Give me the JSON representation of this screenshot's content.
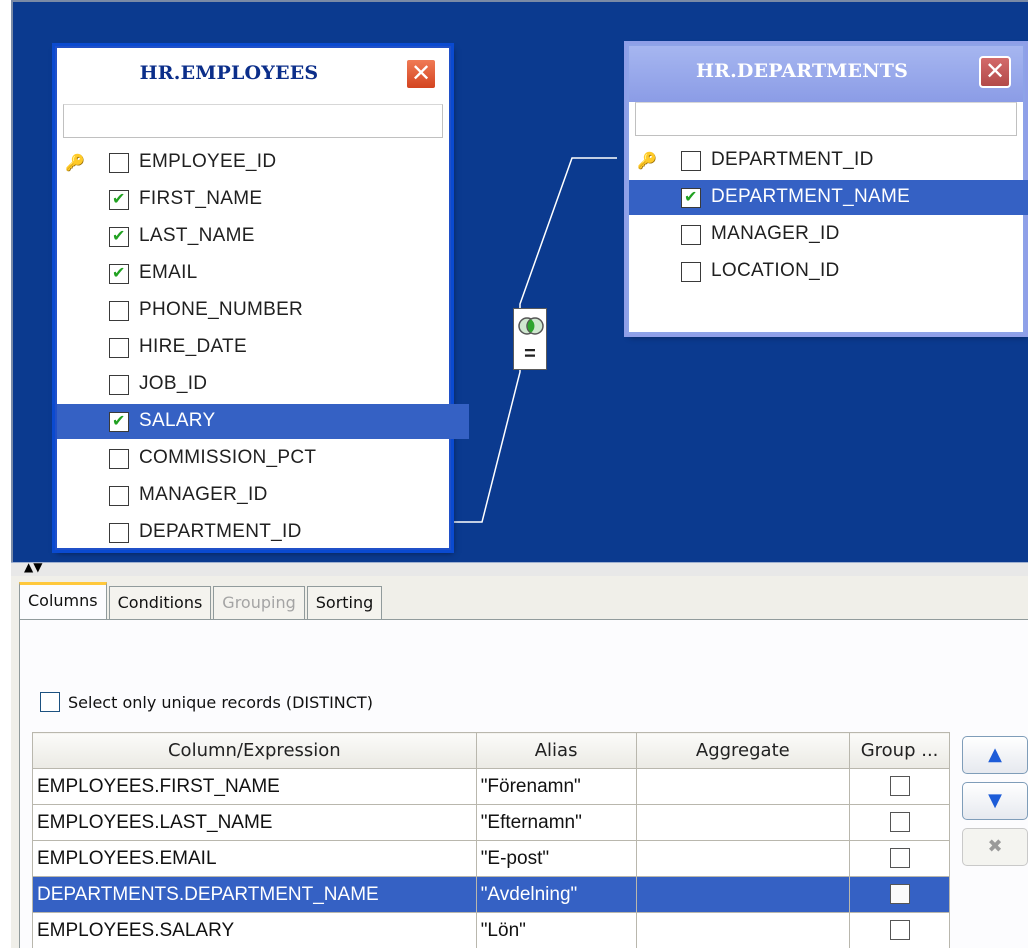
{
  "employees_table": {
    "title": "HR.EMPLOYEES",
    "close_icon": "close-icon",
    "fields": [
      {
        "name": "EMPLOYEE_ID",
        "checked": false,
        "key": true,
        "selected": false
      },
      {
        "name": "FIRST_NAME",
        "checked": true,
        "key": false,
        "selected": false
      },
      {
        "name": "LAST_NAME",
        "checked": true,
        "key": false,
        "selected": false
      },
      {
        "name": "EMAIL",
        "checked": true,
        "key": false,
        "selected": false
      },
      {
        "name": "PHONE_NUMBER",
        "checked": false,
        "key": false,
        "selected": false
      },
      {
        "name": "HIRE_DATE",
        "checked": false,
        "key": false,
        "selected": false
      },
      {
        "name": "JOB_ID",
        "checked": false,
        "key": false,
        "selected": false
      },
      {
        "name": "SALARY",
        "checked": true,
        "key": false,
        "selected": true
      },
      {
        "name": "COMMISSION_PCT",
        "checked": false,
        "key": false,
        "selected": false
      },
      {
        "name": "MANAGER_ID",
        "checked": false,
        "key": false,
        "selected": false
      },
      {
        "name": "DEPARTMENT_ID",
        "checked": false,
        "key": false,
        "selected": false
      }
    ]
  },
  "departments_table": {
    "title": "HR.DEPARTMENTS",
    "close_icon": "close-icon",
    "fields": [
      {
        "name": "DEPARTMENT_ID",
        "checked": false,
        "key": true,
        "selected": false
      },
      {
        "name": "DEPARTMENT_NAME",
        "checked": true,
        "key": false,
        "selected": true
      },
      {
        "name": "MANAGER_ID",
        "checked": false,
        "key": false,
        "selected": false
      },
      {
        "name": "LOCATION_ID",
        "checked": false,
        "key": false,
        "selected": false
      }
    ]
  },
  "join": {
    "operator": "=",
    "icon": "join-venn-icon"
  },
  "tabs": [
    {
      "label": "Columns",
      "active": true,
      "disabled": false
    },
    {
      "label": "Conditions",
      "active": false,
      "disabled": false
    },
    {
      "label": "Grouping",
      "active": false,
      "disabled": true
    },
    {
      "label": "Sorting",
      "active": false,
      "disabled": false
    }
  ],
  "distinct_label": "Select only unique records (DISTINCT)",
  "grid": {
    "headers": [
      "Column/Expression",
      "Alias",
      "Aggregate",
      "Group ..."
    ],
    "rows": [
      {
        "column": "EMPLOYEES.FIRST_NAME",
        "alias": "\"Förenamn\"",
        "aggregate": "",
        "group": false,
        "selected": false
      },
      {
        "column": "EMPLOYEES.LAST_NAME",
        "alias": "\"Efternamn\"",
        "aggregate": "",
        "group": false,
        "selected": false
      },
      {
        "column": "EMPLOYEES.EMAIL",
        "alias": "\"E-post\"",
        "aggregate": "",
        "group": false,
        "selected": false
      },
      {
        "column": "DEPARTMENTS.DEPARTMENT_NAME",
        "alias": "\"Avdelning\"",
        "aggregate": "",
        "group": false,
        "selected": true
      },
      {
        "column": "EMPLOYEES.SALARY",
        "alias": "\"Lön\"",
        "aggregate": "",
        "group": false,
        "selected": false
      },
      {
        "column": "",
        "alias": "",
        "aggregate": "",
        "group": false,
        "selected": false
      }
    ]
  },
  "side_buttons": {
    "up_icon": "chevron-up-icon",
    "down_icon": "chevron-down-icon",
    "delete_icon": "delete-x-icon"
  },
  "colors": {
    "diagram_bg": "#0b3a8f",
    "selection": "#3561c4",
    "check_green": "#21a121"
  }
}
